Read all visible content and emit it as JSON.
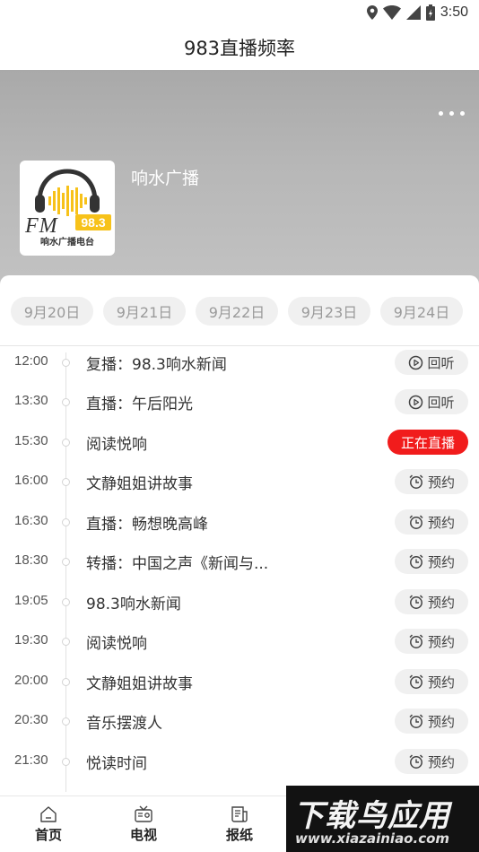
{
  "status_bar": {
    "time": "3:50",
    "icons": [
      "location-icon",
      "wifi-icon",
      "signal-icon",
      "battery-icon"
    ]
  },
  "header": {
    "title": "983直播频率"
  },
  "station": {
    "name": "响水广播",
    "logo": {
      "text_fm": "FM",
      "text_freq": "98.3",
      "text_caption": "响水广播电台"
    }
  },
  "dates": [
    {
      "label": "9月20日"
    },
    {
      "label": "9月21日"
    },
    {
      "label": "9月22日"
    },
    {
      "label": "9月23日"
    },
    {
      "label": "9月24日"
    }
  ],
  "programs": [
    {
      "time": "12:00",
      "title": "复播：98.3响水新闻",
      "action": "回听",
      "type": "replay"
    },
    {
      "time": "13:30",
      "title": "直播：午后阳光",
      "action": "回听",
      "type": "replay"
    },
    {
      "time": "15:30",
      "title": "阅读悦响",
      "action": "正在直播",
      "type": "live"
    },
    {
      "time": "16:00",
      "title": "文静姐姐讲故事",
      "action": "预约",
      "type": "reserve"
    },
    {
      "time": "16:30",
      "title": "直播：畅想晚高峰",
      "action": "预约",
      "type": "reserve"
    },
    {
      "time": "18:30",
      "title": "转播：中国之声《新闻与...",
      "action": "预约",
      "type": "reserve"
    },
    {
      "time": "19:05",
      "title": "98.3响水新闻",
      "action": "预约",
      "type": "reserve"
    },
    {
      "time": "19:30",
      "title": "阅读悦响",
      "action": "预约",
      "type": "reserve"
    },
    {
      "time": "20:00",
      "title": "文静姐姐讲故事",
      "action": "预约",
      "type": "reserve"
    },
    {
      "time": "20:30",
      "title": "音乐摆渡人",
      "action": "预约",
      "type": "reserve"
    },
    {
      "time": "21:30",
      "title": "悦读时间",
      "action": "预约",
      "type": "reserve"
    }
  ],
  "tabbar": {
    "items": [
      {
        "label": "首页",
        "icon": "home-icon"
      },
      {
        "label": "电视",
        "icon": "tv-icon"
      },
      {
        "label": "报纸",
        "icon": "newspaper-icon"
      }
    ]
  },
  "watermark": {
    "title": "下载鸟应用",
    "url": "www.xiazainiao.com"
  },
  "colors": {
    "live": "#f11c1c",
    "logo_yellow": "#f7c21a",
    "banner": "#b3b3b3"
  }
}
